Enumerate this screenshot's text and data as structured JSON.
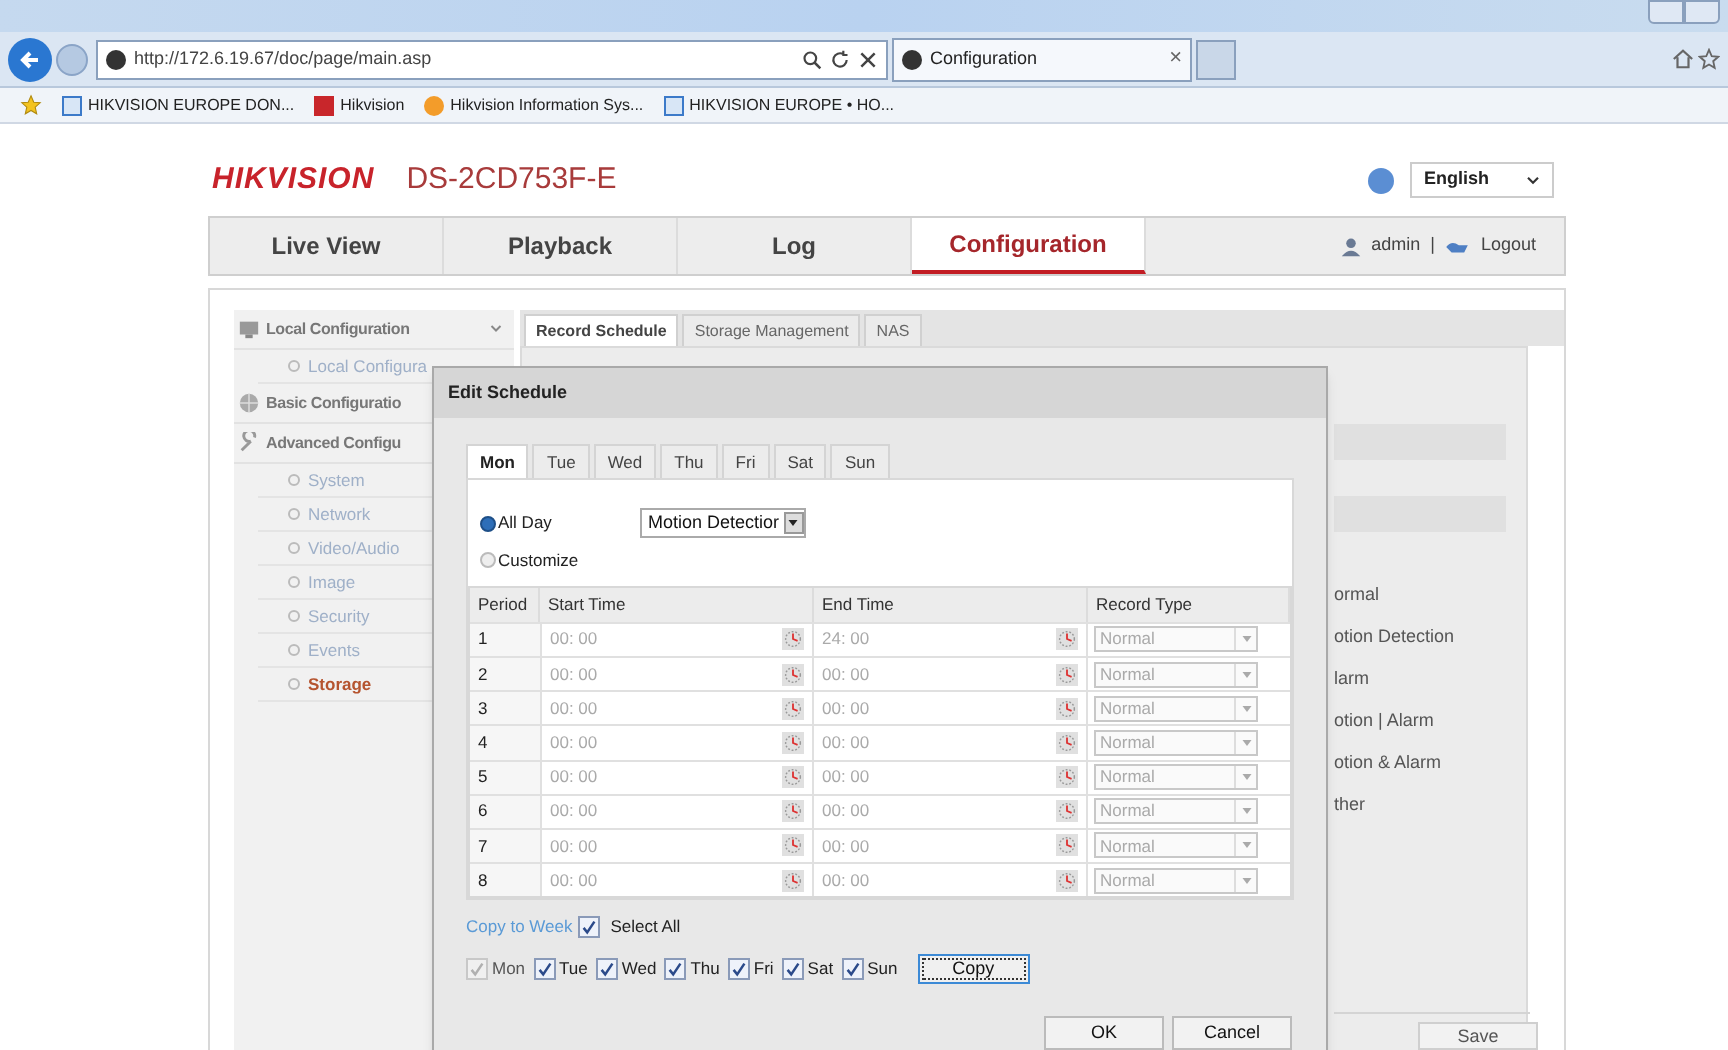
{
  "browser": {
    "address": "http://172.6.19.67/doc/page/main.asp",
    "tab": {
      "title": "Configuration",
      "close": "×"
    },
    "favorites": [
      "HIKVISION EUROPE DON...",
      "Hikvision",
      "Hikvision Information Sys...",
      "HIKVISION EUROPE • HO..."
    ]
  },
  "header": {
    "logo": "HIKVISION",
    "model": "DS-2CD753F-E",
    "language": "English"
  },
  "nav": {
    "tabs": [
      {
        "label": "Live View",
        "selected": false
      },
      {
        "label": "Playback",
        "selected": false
      },
      {
        "label": "Log",
        "selected": false
      },
      {
        "label": "Configuration",
        "selected": true
      }
    ],
    "user": "admin",
    "separator": "|",
    "logout": "Logout"
  },
  "sidebar": {
    "items": [
      {
        "label": "Local Configuration",
        "kind": "local",
        "expanded": true,
        "children": [
          {
            "label": "Local Configura",
            "selected": false
          }
        ]
      },
      {
        "label": "Basic Configuratio",
        "kind": "basic"
      },
      {
        "label": "Advanced Configu",
        "kind": "advanced",
        "children": [
          {
            "label": "System",
            "selected": false
          },
          {
            "label": "Network",
            "selected": false
          },
          {
            "label": "Video/Audio",
            "selected": false
          },
          {
            "label": "Image",
            "selected": false
          },
          {
            "label": "Security",
            "selected": false
          },
          {
            "label": "Events",
            "selected": false
          },
          {
            "label": "Storage",
            "selected": true
          }
        ]
      }
    ]
  },
  "subtabs": [
    {
      "label": "Record Schedule",
      "selected": true
    },
    {
      "label": "Storage Management",
      "selected": false
    },
    {
      "label": "NAS",
      "selected": false
    }
  ],
  "legend": [
    "ormal",
    "otion Detection",
    "larm",
    "otion | Alarm",
    "otion & Alarm",
    "ther"
  ],
  "save": "Save",
  "dialog": {
    "title": "Edit Schedule",
    "days": [
      {
        "label": "Mon",
        "selected": true
      },
      {
        "label": "Tue",
        "selected": false
      },
      {
        "label": "Wed",
        "selected": false
      },
      {
        "label": "Thu",
        "selected": false
      },
      {
        "label": "Fri",
        "selected": false
      },
      {
        "label": "Sat",
        "selected": false
      },
      {
        "label": "Sun",
        "selected": false
      }
    ],
    "modes": [
      {
        "label": "All Day",
        "selected": true
      },
      {
        "label": "Customize",
        "selected": false
      }
    ],
    "record_type": "Motion Detectior",
    "columns": [
      "Period",
      "Start Time",
      "End Time",
      "Record Type"
    ],
    "rows": [
      {
        "period": "1",
        "start": "00: 00",
        "end": "24: 00",
        "type": "Normal"
      },
      {
        "period": "2",
        "start": "00: 00",
        "end": "00: 00",
        "type": "Normal"
      },
      {
        "period": "3",
        "start": "00: 00",
        "end": "00: 00",
        "type": "Normal"
      },
      {
        "period": "4",
        "start": "00: 00",
        "end": "00: 00",
        "type": "Normal"
      },
      {
        "period": "5",
        "start": "00: 00",
        "end": "00: 00",
        "type": "Normal"
      },
      {
        "period": "6",
        "start": "00: 00",
        "end": "00: 00",
        "type": "Normal"
      },
      {
        "period": "7",
        "start": "00: 00",
        "end": "00: 00",
        "type": "Normal"
      },
      {
        "period": "8",
        "start": "00: 00",
        "end": "00: 00",
        "type": "Normal"
      }
    ],
    "copy_link": "Copy to Week",
    "select_all": {
      "label": "Select All",
      "checked": true
    },
    "copy_days": [
      {
        "label": "Mon",
        "checked": true,
        "disabled": true
      },
      {
        "label": "Tue",
        "checked": true,
        "disabled": false
      },
      {
        "label": "Wed",
        "checked": true,
        "disabled": false
      },
      {
        "label": "Thu",
        "checked": true,
        "disabled": false
      },
      {
        "label": "Fri",
        "checked": true,
        "disabled": false
      },
      {
        "label": "Sat",
        "checked": true,
        "disabled": false
      },
      {
        "label": "Sun",
        "checked": true,
        "disabled": false
      }
    ],
    "copy": "Copy",
    "ok": "OK",
    "cancel": "Cancel"
  }
}
